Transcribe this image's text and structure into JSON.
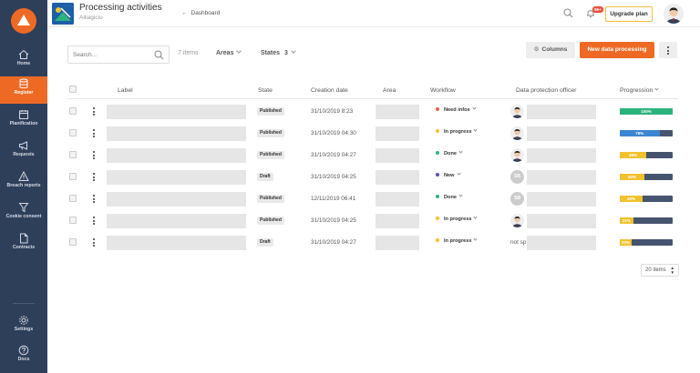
{
  "header": {
    "title": "Processing activities",
    "org": "Alliagicio",
    "back_label": "Dashboard",
    "notif_badge": "99+",
    "upgrade_label": "Upgrade plan"
  },
  "sidebar": {
    "items": [
      {
        "label": "Home",
        "icon": "home-icon"
      },
      {
        "label": "Register",
        "icon": "database-icon",
        "active": true
      },
      {
        "label": "Planification",
        "icon": "calendar-icon"
      },
      {
        "label": "Requests",
        "icon": "megaphone-icon"
      },
      {
        "label": "Breach reports",
        "icon": "warning-icon"
      },
      {
        "label": "Cookie consent",
        "icon": "funnel-icon"
      },
      {
        "label": "Contracts",
        "icon": "document-icon"
      }
    ],
    "bottom": [
      {
        "label": "Settings",
        "icon": "gear-icon"
      },
      {
        "label": "Docs",
        "icon": "help-icon"
      }
    ]
  },
  "toolbar": {
    "search_placeholder": "Search...",
    "items_count": "7 items",
    "areas_label": "Areas",
    "states_label": "States",
    "states_count": "3",
    "columns_label": "Columns",
    "new_label": "New data processing"
  },
  "table": {
    "headers": {
      "label": "Label",
      "state": "State",
      "creation_date": "Creation date",
      "area": "Area",
      "workflow": "Workflow",
      "dpo": "Data protection officer",
      "progression": "Progression"
    },
    "rows": [
      {
        "state": "Published",
        "date": "31/10/2019 8:23",
        "workflow": "Need infos",
        "wf_color": "#e8643c",
        "dpo": "avatar",
        "dpo_text": "",
        "progress": 100,
        "progress_label": "100%",
        "progress_color": "#2db37e"
      },
      {
        "state": "Published",
        "date": "31/10/2019 04:30",
        "workflow": "In progress",
        "wf_color": "#f2c12e",
        "dpo": "avatar",
        "dpo_text": "",
        "progress": 75,
        "progress_label": "75%",
        "progress_color": "#3b86d1"
      },
      {
        "state": "Published",
        "date": "31/10/2019 04:27",
        "workflow": "Done",
        "wf_color": "#2db37e",
        "dpo": "avatar",
        "dpo_text": "",
        "progress": 50,
        "progress_label": "46%",
        "progress_color": "#f2c12e"
      },
      {
        "state": "Draft",
        "date": "31/10/2019 04:25",
        "workflow": "New",
        "wf_color": "#5c4fb0",
        "dpo": "initials",
        "dpo_text": "SB",
        "progress": 46,
        "progress_label": "40%",
        "progress_color": "#f2c12e"
      },
      {
        "state": "Published",
        "date": "12/11/2019 06:41",
        "workflow": "Done",
        "wf_color": "#2db37e",
        "dpo": "initials",
        "dpo_text": "SB",
        "progress": 43,
        "progress_label": "40%",
        "progress_color": "#f2c12e"
      },
      {
        "state": "Published",
        "date": "31/10/2019 04:25",
        "workflow": "In progress",
        "wf_color": "#f2c12e",
        "dpo": "avatar",
        "dpo_text": "",
        "progress": 25,
        "progress_label": "21%",
        "progress_color": "#f2c12e"
      },
      {
        "state": "Draft",
        "date": "31/10/2019 04:27",
        "workflow": "In progress",
        "wf_color": "#f2c12e",
        "dpo": "text",
        "dpo_text": "not sp",
        "progress": 22,
        "progress_label": "20%",
        "progress_color": "#f2c12e"
      }
    ]
  },
  "pagination": {
    "page_size": "20 items"
  }
}
